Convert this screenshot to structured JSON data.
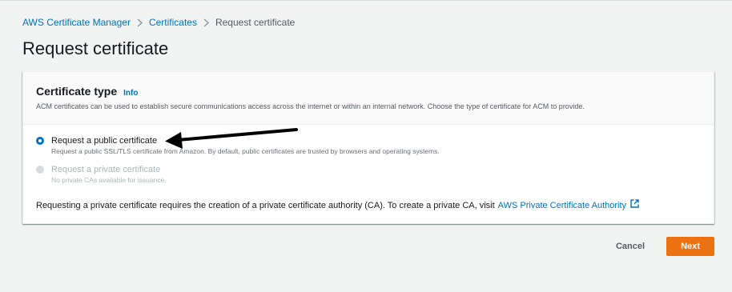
{
  "breadcrumb": {
    "items": [
      {
        "label": "AWS Certificate Manager"
      },
      {
        "label": "Certificates"
      },
      {
        "label": "Request certificate"
      }
    ]
  },
  "page": {
    "title": "Request certificate"
  },
  "certificate_type": {
    "title": "Certificate type",
    "info_label": "Info",
    "description": "ACM certificates can be used to establish secure communications access across the internet or within an internal network. Choose the type of certificate for ACM to provide.",
    "options": [
      {
        "label": "Request a public certificate",
        "description": "Request a public SSL/TLS certificate from Amazon. By default, public certificates are trusted by browsers and operating systems.",
        "selected": true,
        "disabled": false
      },
      {
        "label": "Request a private certificate",
        "description": "No private CAs available for issuance.",
        "selected": false,
        "disabled": true
      }
    ],
    "footnote_text": "Requesting a private certificate requires the creation of a private certificate authority (CA). To create a private CA, visit",
    "footnote_link": "AWS Private Certificate Authority",
    "footnote_icon": "external-link-icon"
  },
  "actions": {
    "cancel_label": "Cancel",
    "next_label": "Next"
  },
  "colors": {
    "link": "#0073bb",
    "primary_button": "#ec7211",
    "background": "#f2f3f3",
    "annotation_arrow": "#000000"
  }
}
